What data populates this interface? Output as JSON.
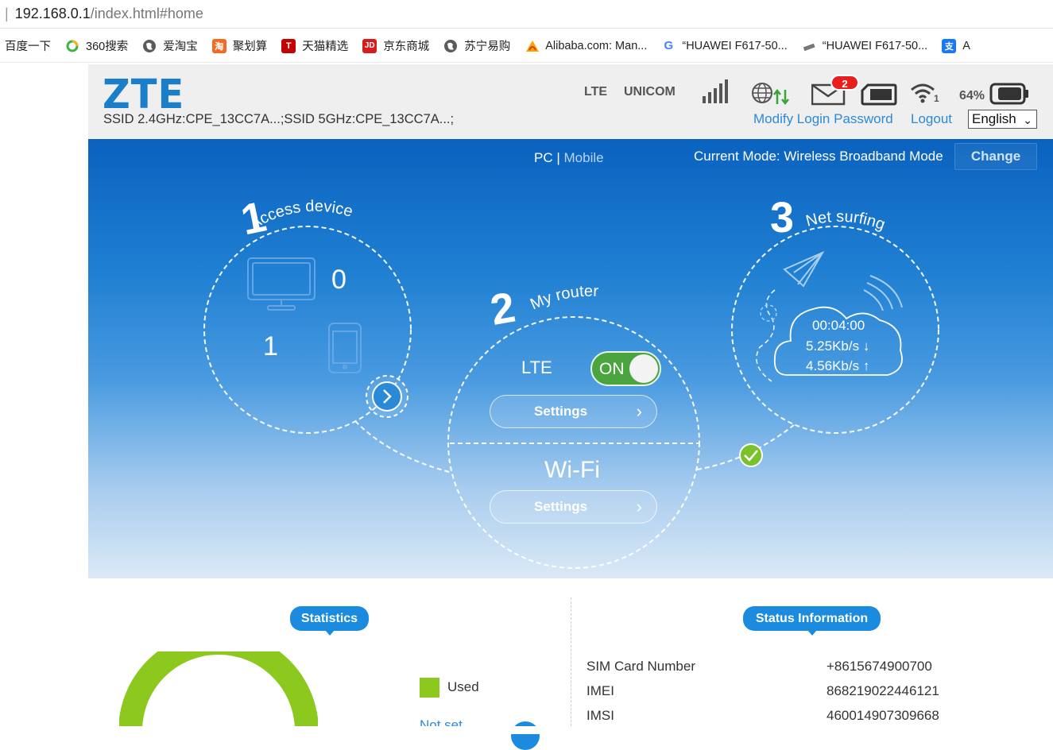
{
  "browser": {
    "url_host": "192.168.0.1",
    "url_path": "/index.html#home",
    "bookmarks": [
      {
        "label": "百度一下",
        "icon": "none"
      },
      {
        "label": "360搜索",
        "icon": "360-icon"
      },
      {
        "label": "爱淘宝",
        "icon": "globe-icon"
      },
      {
        "label": "聚划算",
        "icon": "juhuasuan-icon"
      },
      {
        "label": "天猫精选",
        "icon": "tmall-icon"
      },
      {
        "label": "京东商城",
        "icon": "jd-icon"
      },
      {
        "label": "苏宁易购",
        "icon": "globe-icon"
      },
      {
        "label": "Alibaba.com: Man...",
        "icon": "alibaba-icon"
      },
      {
        "label": "“HUAWEI F617-50...",
        "icon": "google-icon"
      },
      {
        "label": "“HUAWEI F617-50...",
        "icon": "router-icon"
      },
      {
        "label": "A",
        "icon": "alipay-icon"
      }
    ]
  },
  "header": {
    "logo": "ZTE",
    "ssid": "SSID 2.4GHz:CPE_13CC7A...;SSID 5GHz:CPE_13CC7A...;",
    "network_type": "LTE",
    "operator": "UNICOM",
    "unread_messages": "2",
    "wifi_clients": "1",
    "battery_percent": "64%",
    "modify_password": "Modify Login Password",
    "logout": "Logout",
    "language": "English"
  },
  "banner": {
    "pc_label": "PC",
    "separator": " | ",
    "mobile_label": "Mobile",
    "mode_text": "Current Mode: Wireless Broadband Mode",
    "change_label": "Change",
    "step1": {
      "number": "1",
      "title": "Access device",
      "pc_count": "0",
      "phone_count": "1"
    },
    "step2": {
      "number": "2",
      "title": "My router",
      "lte_label": "LTE",
      "lte_state": "ON",
      "settings": "Settings",
      "wifi_label": "Wi-Fi"
    },
    "step3": {
      "number": "3",
      "title": "Net surfing",
      "duration": "00:04:00",
      "download": "5.25Kb/s ↓",
      "upload": "4.56Kb/s ↑"
    }
  },
  "statistics": {
    "tab": "Statistics",
    "used_label": "Used",
    "not_set_label": "Not set",
    "colors": {
      "used": "#8cc81d",
      "accent": "#1b8be0"
    }
  },
  "status": {
    "tab": "Status Information",
    "rows": [
      {
        "key": "SIM Card Number",
        "value": "+8615674900700"
      },
      {
        "key": "IMEI",
        "value": "868219022446121"
      },
      {
        "key": "IMSI",
        "value": "460014907309668"
      }
    ]
  }
}
